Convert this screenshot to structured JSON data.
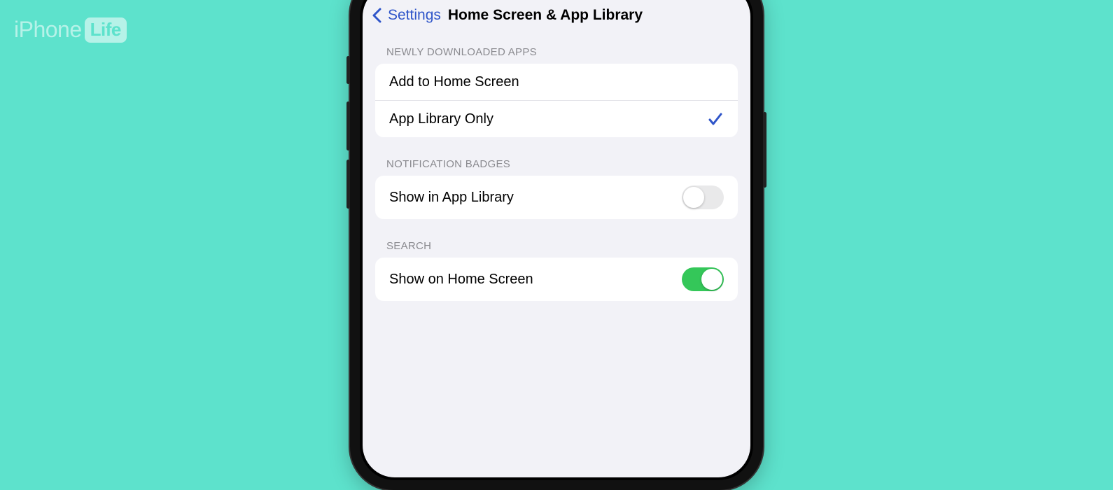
{
  "watermark": {
    "prefix": "iPhone",
    "badge": "Life"
  },
  "nav": {
    "back_label": "Settings",
    "title": "Home Screen & App Library"
  },
  "sections": {
    "newly_downloaded": {
      "header": "NEWLY DOWNLOADED APPS",
      "options": [
        {
          "label": "Add to Home Screen",
          "selected": false
        },
        {
          "label": "App Library Only",
          "selected": true
        }
      ]
    },
    "notification_badges": {
      "header": "NOTIFICATION BADGES",
      "row": {
        "label": "Show in App Library",
        "enabled": false
      }
    },
    "search": {
      "header": "SEARCH",
      "row": {
        "label": "Show on Home Screen",
        "enabled": true
      }
    }
  },
  "colors": {
    "accent": "#2f55c9",
    "toggle_on": "#34c759",
    "bg": "#5de2cc"
  }
}
